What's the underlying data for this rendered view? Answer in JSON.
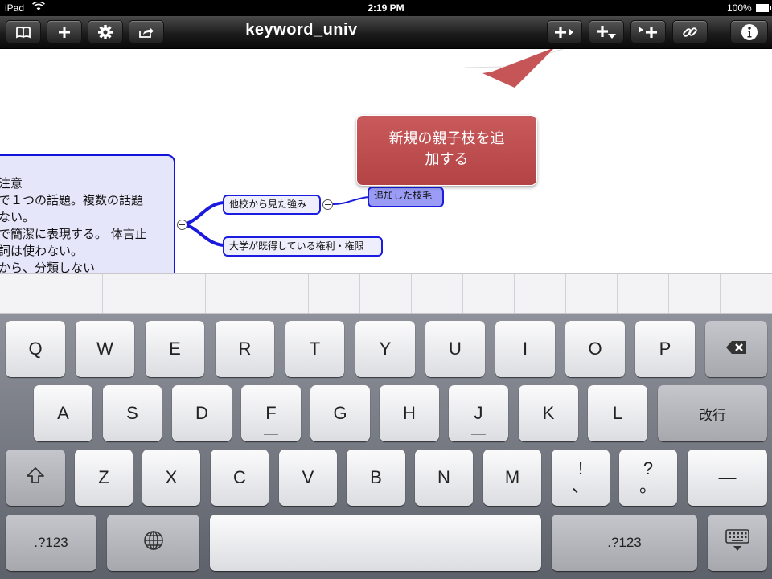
{
  "status_bar": {
    "device": "iPad",
    "time": "2:19 PM",
    "battery": "100%"
  },
  "toolbar": {
    "title": "keyword_univ",
    "left_icons": [
      "book-icon",
      "plus-icon",
      "gear-icon",
      "share-icon"
    ],
    "right_icons": [
      "add-child-icon",
      "add-sibling-icon",
      "add-parent-icon",
      "link-icon",
      "info-icon"
    ]
  },
  "tooltip": {
    "lines": [
      "新規の親子枝を追",
      "加する"
    ],
    "color": "#b94a4c"
  },
  "mindmap": {
    "main_node_lines": [
      "注意",
      "で１つの話題。複数の話題",
      "ない。",
      "で簡潔に表現する。 体言止",
      "詞は使わない。",
      "から、分類しない"
    ],
    "child_nodes": [
      "他校から見た強み",
      "大学が既得している権利・権限"
    ],
    "grandchild_node": "追加した枝毛",
    "branch_color": "#1a1adf"
  },
  "keyboard": {
    "row1": [
      "Q",
      "W",
      "E",
      "R",
      "T",
      "Y",
      "U",
      "I",
      "O",
      "P"
    ],
    "row2": [
      "A",
      "S",
      "D",
      "F",
      "G",
      "H",
      "J",
      "K",
      "L"
    ],
    "return_label": "改行",
    "row3": [
      "Z",
      "X",
      "C",
      "V",
      "B",
      "N",
      "M"
    ],
    "punct1": [
      "!",
      "、"
    ],
    "punct2": [
      "?",
      "。"
    ],
    "dash_label": "—",
    "numbers_label": ".?123",
    "icons": {
      "backspace": "backspace-icon",
      "shift": "shift-icon",
      "globe": "globe-icon",
      "dismiss": "keyboard-dismiss-icon"
    }
  }
}
